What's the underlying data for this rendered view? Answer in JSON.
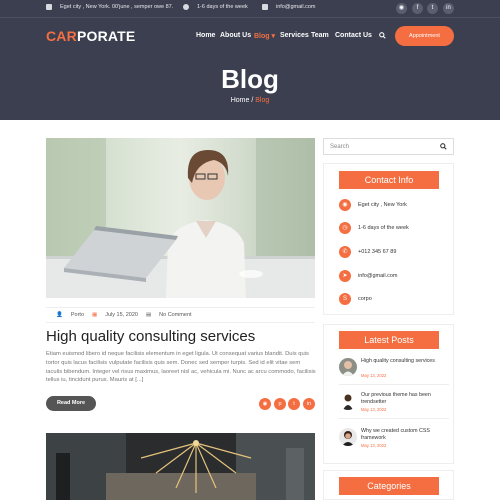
{
  "topbar": {
    "address": "Eget city , New York. 00'june , semper owe 87.",
    "hours": "1-6 days of the week",
    "email": "info@gmail.com",
    "social": [
      {
        "icon": "rss-icon",
        "glyph": "◉"
      },
      {
        "icon": "facebook-icon",
        "glyph": "f"
      },
      {
        "icon": "twitter-icon",
        "glyph": "t"
      },
      {
        "icon": "linkedin-icon",
        "glyph": "in"
      }
    ]
  },
  "brand": {
    "logo_accent": "CAR",
    "logo_rest": "PORATE",
    "accent_color": "#f56e42",
    "header_bg": "#3b3f4f"
  },
  "nav": {
    "items": [
      {
        "label": "Home"
      },
      {
        "label": "About Us"
      },
      {
        "label": "Blog ▾",
        "active": true
      },
      {
        "label": "Services"
      },
      {
        "label": "Team"
      },
      {
        "label": "Contact Us"
      }
    ],
    "appointment": "Appointment"
  },
  "hero": {
    "title": "Blog",
    "crumb_home": "Home",
    "crumb_sep": " / ",
    "crumb_current": "Blog"
  },
  "post": {
    "author": "Porto",
    "date": "July 15, 2020",
    "comments": "No Comment",
    "title": "High quality consulting services",
    "excerpt": "Etiam euismod libero id neque facilisis elementum in eget ligula. Ut consequat varius blandit. Duis quis tortor quis lacus facilisis vulputate facilisis quis sem. Donec sed semper turpis. Sed id elit vitae sem iaculis bibendum. Integer vel risus maximus, laoreet nisl ac, vehicula mi. Nunc ac arcu commodo, facilisis tellus iu, tincidunt purus. Mauris at [...]",
    "read_more": "Read More",
    "share": [
      {
        "icon": "rss-icon",
        "glyph": "◉"
      },
      {
        "icon": "pinterest-icon",
        "glyph": "p"
      },
      {
        "icon": "twitter-icon",
        "glyph": "t"
      },
      {
        "icon": "linkedin-icon",
        "glyph": "in"
      }
    ]
  },
  "sidebar": {
    "search_placeholder": "Search",
    "contact": {
      "heading": "Contact Info",
      "rows": [
        {
          "icon": "location-icon",
          "glyph": "◉",
          "text": "Eget city , New York"
        },
        {
          "icon": "clock-icon",
          "glyph": "◷",
          "text": "1-6 days of the week"
        },
        {
          "icon": "phone-icon",
          "glyph": "✆",
          "text": "+012 345 67 89"
        },
        {
          "icon": "send-icon",
          "glyph": "➤",
          "text": "info@gmail.com"
        },
        {
          "icon": "skype-icon",
          "glyph": "S",
          "text": "corpo"
        }
      ]
    },
    "latest": {
      "heading": "Latest Posts",
      "items": [
        {
          "title": "High quality consulting services",
          "date": "May 13, 2022"
        },
        {
          "title": "Our previous theme has been trendsetter",
          "date": "May 13, 2022"
        },
        {
          "title": "Why we created custom CSS framework",
          "date": "May 13, 2022"
        }
      ]
    },
    "categories": {
      "heading": "Categories"
    }
  }
}
